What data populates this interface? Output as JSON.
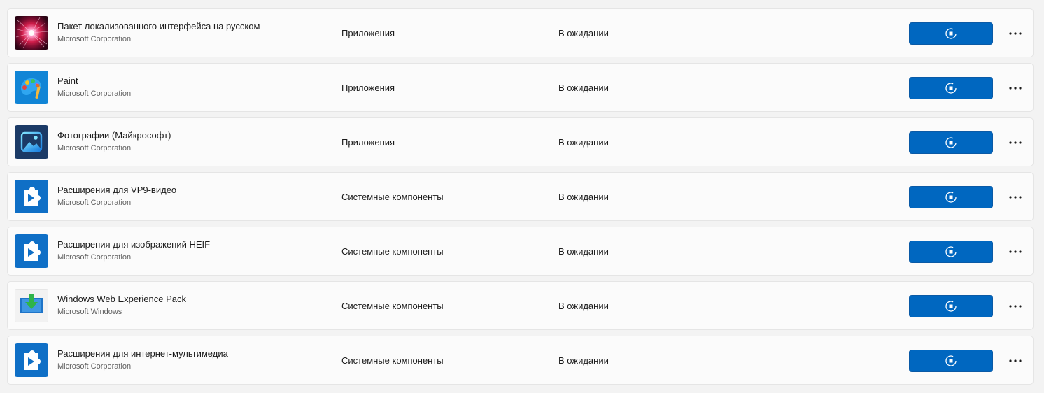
{
  "colors": {
    "accent": "#0067c0",
    "row_background": "#fbfbfb",
    "page_background": "#f3f3f3"
  },
  "apps": [
    {
      "name": "Пакет локализованного интерфейса на русском",
      "publisher": "Microsoft Corporation",
      "category": "Приложения",
      "status": "В ожидании",
      "icon": "language-pack-icon"
    },
    {
      "name": "Paint",
      "publisher": "Microsoft Corporation",
      "category": "Приложения",
      "status": "В ожидании",
      "icon": "paint-icon"
    },
    {
      "name": "Фотографии (Майкрософт)",
      "publisher": "Microsoft Corporation",
      "category": "Приложения",
      "status": "В ожидании",
      "icon": "photos-icon"
    },
    {
      "name": "Расширения для VP9-видео",
      "publisher": "Microsoft Corporation",
      "category": "Системные компоненты",
      "status": "В ожидании",
      "icon": "media-extension-icon"
    },
    {
      "name": "Расширения для изображений HEIF",
      "publisher": "Microsoft Corporation",
      "category": "Системные компоненты",
      "status": "В ожидании",
      "icon": "media-extension-icon"
    },
    {
      "name": "Windows Web Experience Pack",
      "publisher": "Microsoft Windows",
      "category": "Системные компоненты",
      "status": "В ожидании",
      "icon": "web-experience-pack-icon"
    },
    {
      "name": "Расширения для интернет-мультимедиа",
      "publisher": "Microsoft Corporation",
      "category": "Системные компоненты",
      "status": "В ожидании",
      "icon": "media-extension-icon"
    }
  ]
}
